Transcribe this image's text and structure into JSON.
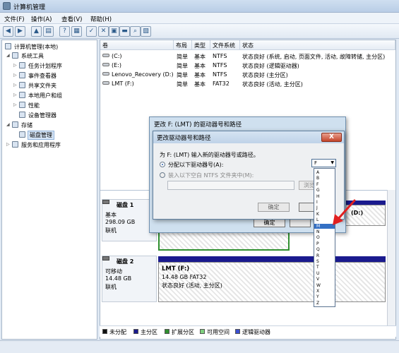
{
  "window": {
    "title": "计算机管理"
  },
  "menu": [
    "文件(F)",
    "操作(A)",
    "查看(V)",
    "帮助(H)"
  ],
  "tree": {
    "root": "计算机管理(本地)",
    "system_tools": "系统工具",
    "task_scheduler": "任务计划程序",
    "event_viewer": "事件查看器",
    "shared_folders": "共享文件夹",
    "local_users": "本地用户和组",
    "performance": "性能",
    "device_manager": "设备管理器",
    "storage": "存储",
    "disk_management": "磁盘管理",
    "services": "服务和应用程序"
  },
  "volumes": {
    "headers": [
      "卷",
      "布局",
      "类型",
      "文件系统",
      "状态"
    ],
    "rows": [
      {
        "name": "(C:)",
        "layout": "简单",
        "type": "基本",
        "fs": "NTFS",
        "status": "状态良好 (系统, 启动, 页面文件, 活动, 故障转储, 主分区)"
      },
      {
        "name": "(E:)",
        "layout": "简单",
        "type": "基本",
        "fs": "NTFS",
        "status": "状态良好 (逻辑驱动器)"
      },
      {
        "name": "Lenovo_Recovery (D:)",
        "layout": "简单",
        "type": "基本",
        "fs": "NTFS",
        "status": "状态良好 (主分区)"
      },
      {
        "name": "LMT (F:)",
        "layout": "简单",
        "type": "基本",
        "fs": "FAT32",
        "status": "状态良好 (活动, 主分区)"
      }
    ]
  },
  "disks": {
    "disk1": {
      "name": "磁盘 1",
      "type": "基本",
      "size": "298.09 GB",
      "state": "联机",
      "part_label": "(D:)"
    },
    "disk2": {
      "name": "磁盘 2",
      "type": "可移动",
      "size": "14.48 GB",
      "state": "联机",
      "part_name": "LMT  (F:)",
      "part_size": "14.48 GB FAT32",
      "part_status": "状态良好 (活动, 主分区)"
    }
  },
  "legend": [
    "未分配",
    "主分区",
    "扩展分区",
    "可用空间",
    "逻辑驱动器"
  ],
  "legend_colors": [
    "#111111",
    "#1a1a8e",
    "#2f8f2f",
    "#7fd17f",
    "#3a4fd1"
  ],
  "outer_dialog": {
    "title": "更改 F: (LMT) 的驱动器号和路径",
    "ok": "确定"
  },
  "inner_dialog": {
    "title": "更改驱动器号和路径",
    "prompt": "为 F: (LMT) 输入新的驱动器号或路径。",
    "option_letter": "分配以下驱动器号(A):",
    "option_folder": "装入以下空白 NTFS 文件夹中(M):",
    "browse": "浏览",
    "ok": "确定",
    "close": "X",
    "selected_letter": "F"
  },
  "drive_letters": [
    "A",
    "B",
    "F",
    "G",
    "H",
    "I",
    "J",
    "K",
    "L",
    "M",
    "N",
    "O",
    "P",
    "Q",
    "R",
    "S",
    "T",
    "U",
    "V",
    "W",
    "X",
    "Y",
    "Z"
  ],
  "highlighted_letter": "M"
}
